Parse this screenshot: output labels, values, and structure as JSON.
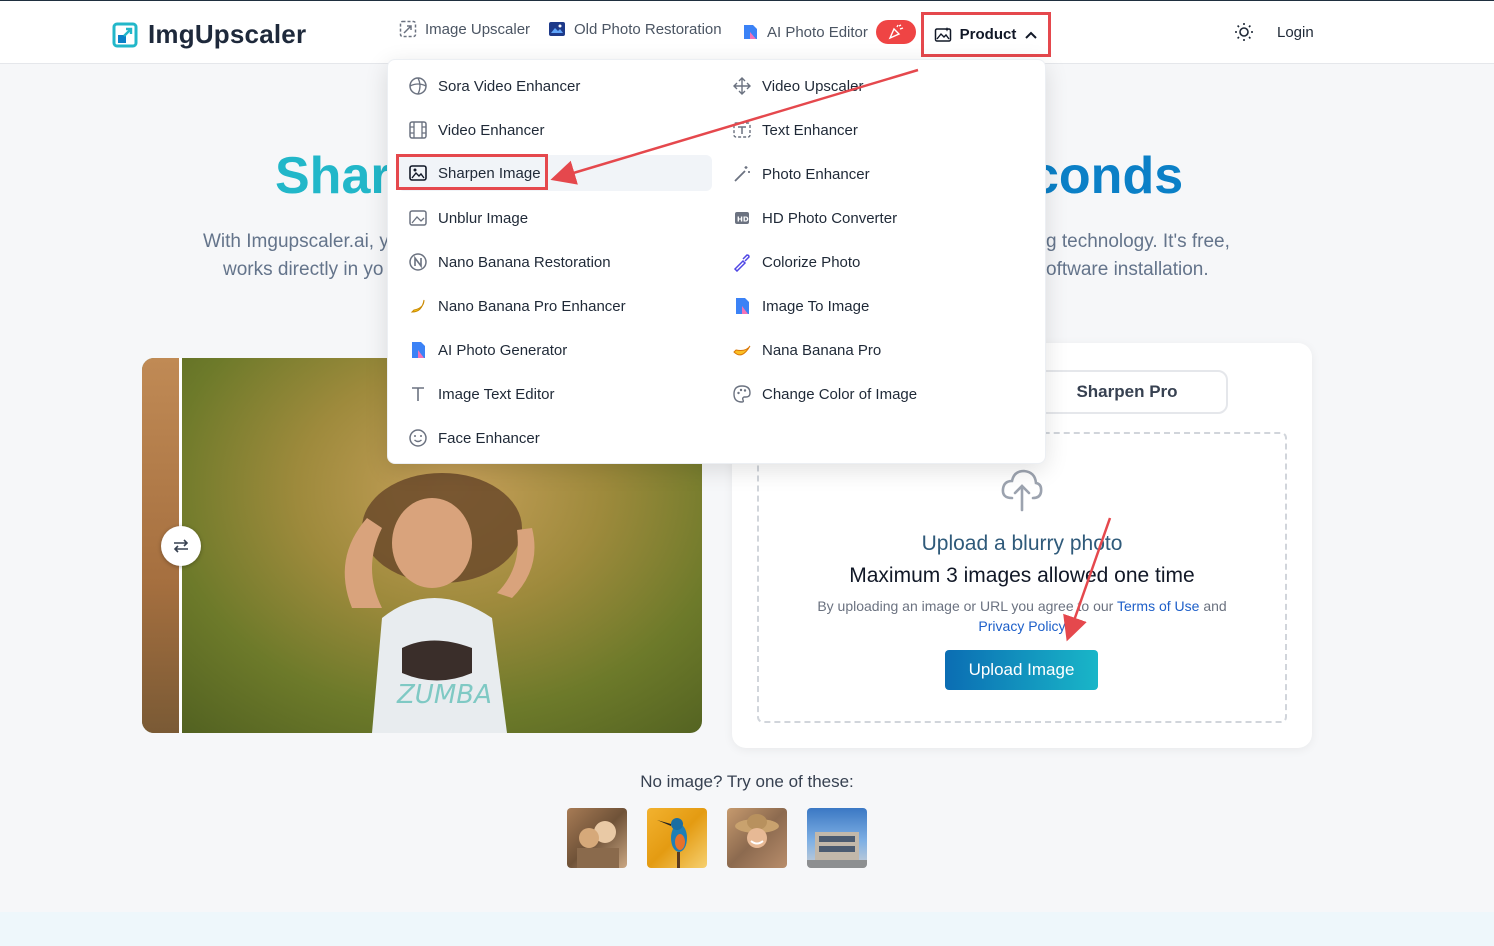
{
  "header": {
    "logo_text": "ImgUpscaler",
    "nav": [
      {
        "label": "Image Upscaler",
        "icon": "image-upscale-icon"
      },
      {
        "label": "Old Photo Restoration",
        "icon": "photo-icon"
      },
      {
        "label": "AI Photo Editor",
        "icon": "ai-editor-icon"
      }
    ],
    "product_label": "Product",
    "login_label": "Login"
  },
  "hero": {
    "title_left": "Sharp",
    "title_right": "conds",
    "subtitle_left_1": "With Imgupscaler.ai, y",
    "subtitle_left_2": "works directly in yo",
    "subtitle_right_1": "g technology. It's free,",
    "subtitle_right_2": "oftware installation."
  },
  "dropdown": {
    "left_items": [
      {
        "label": "Sora Video Enhancer",
        "icon": "sora-icon"
      },
      {
        "label": "Video Enhancer",
        "icon": "film-icon"
      },
      {
        "label": "Sharpen Image",
        "icon": "sharpen-image-icon"
      },
      {
        "label": "Unblur Image",
        "icon": "unblur-icon"
      },
      {
        "label": "Nano Banana Restoration",
        "icon": "nano-n-icon"
      },
      {
        "label": "Nano Banana Pro Enhancer",
        "icon": "banana-icon"
      },
      {
        "label": "AI Photo Generator",
        "icon": "ai-generator-icon"
      },
      {
        "label": "Image Text Editor",
        "icon": "text-t-icon"
      },
      {
        "label": "Face Enhancer",
        "icon": "smile-icon"
      }
    ],
    "right_items": [
      {
        "label": "Video Upscaler",
        "icon": "move-arrows-icon"
      },
      {
        "label": "Text Enhancer",
        "icon": "text-frame-icon"
      },
      {
        "label": "Photo Enhancer",
        "icon": "magic-wand-icon"
      },
      {
        "label": "HD Photo Converter",
        "icon": "hd-icon"
      },
      {
        "label": "Colorize Photo",
        "icon": "pipette-icon"
      },
      {
        "label": "Image To Image",
        "icon": "image-to-image-icon"
      },
      {
        "label": "Nana Banana Pro",
        "icon": "banana-pro-icon"
      },
      {
        "label": "Change Color of Image",
        "icon": "palette-icon"
      }
    ]
  },
  "upload": {
    "tab_pro": "Sharpen Pro",
    "title": "Upload a blurry photo",
    "max": "Maximum 3 images allowed one time",
    "terms_prefix": "By uploading an image or URL you agree to our",
    "terms_link": "Terms of Use",
    "terms_and": "and",
    "privacy_link": "Privacy Policy",
    "button": "Upload Image"
  },
  "samples": {
    "prompt": "No image? Try one of these:"
  },
  "colors": {
    "accent": "#22b7c9",
    "accent_dark": "#0b80c7",
    "highlight": "#e5484d"
  }
}
